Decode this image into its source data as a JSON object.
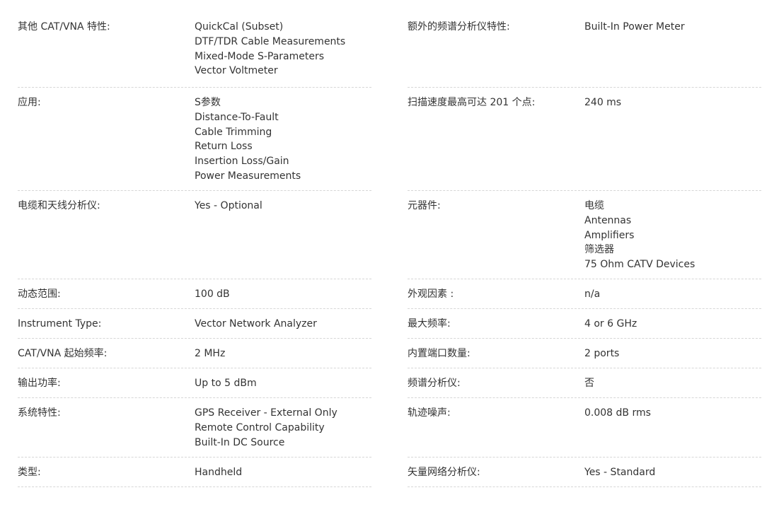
{
  "left": [
    {
      "label": "其他 CAT/VNA 特性:",
      "values": [
        "QuickCal (Subset)",
        "DTF/TDR Cable Measurements",
        "Mixed-Mode S-Parameters",
        "Vector Voltmeter"
      ],
      "height": 105
    },
    {
      "label": "应用:",
      "values": [
        "S参数",
        "Distance-To-Fault",
        "Cable Trimming",
        "Return Loss",
        "Insertion Loss/Gain",
        "Power Measurements"
      ],
      "height": 146
    },
    {
      "label": "电缆和天线分析仪:",
      "values": [
        "Yes - Optional"
      ],
      "height": 125
    },
    {
      "label": "动态范围:",
      "values": [
        "100 dB"
      ],
      "height": 42
    },
    {
      "label": "Instrument Type:",
      "values": [
        "Vector Network Analyzer"
      ],
      "height": 42
    },
    {
      "label": "CAT/VNA 起始频率:",
      "values": [
        "2 MHz"
      ],
      "height": 42
    },
    {
      "label": "输出功率:",
      "values": [
        "Up to 5 dBm"
      ],
      "height": 42
    },
    {
      "label": "系统特性:",
      "values": [
        "GPS Receiver - External Only",
        "Remote Control Capability",
        "Built-In DC Source"
      ],
      "height": 84
    },
    {
      "label": "类型:",
      "values": [
        "Handheld"
      ],
      "height": 42
    }
  ],
  "right": [
    {
      "label": "额外的频谱分析仪特性:",
      "values": [
        "Built-In Power Meter"
      ],
      "height": 105
    },
    {
      "label": "扫描速度最高可达 201 个点:",
      "values": [
        "240 ms"
      ],
      "height": 146
    },
    {
      "label": "元器件:",
      "values": [
        "电缆",
        "Antennas",
        "Amplifiers",
        "筛选器",
        "75 Ohm CATV Devices"
      ],
      "height": 125
    },
    {
      "label": "外观因素 :",
      "values": [
        "n/a"
      ],
      "height": 42
    },
    {
      "label": "最大频率:",
      "values": [
        "4 or 6 GHz"
      ],
      "height": 42
    },
    {
      "label": "内置端口数量:",
      "values": [
        "2 ports"
      ],
      "height": 42
    },
    {
      "label": "频谱分析仪:",
      "values": [
        "否"
      ],
      "height": 42
    },
    {
      "label": "轨迹噪声:",
      "values": [
        "0.008 dB rms"
      ],
      "height": 84
    },
    {
      "label": "矢量网络分析仪:",
      "values": [
        "Yes - Standard"
      ],
      "height": 42
    }
  ]
}
